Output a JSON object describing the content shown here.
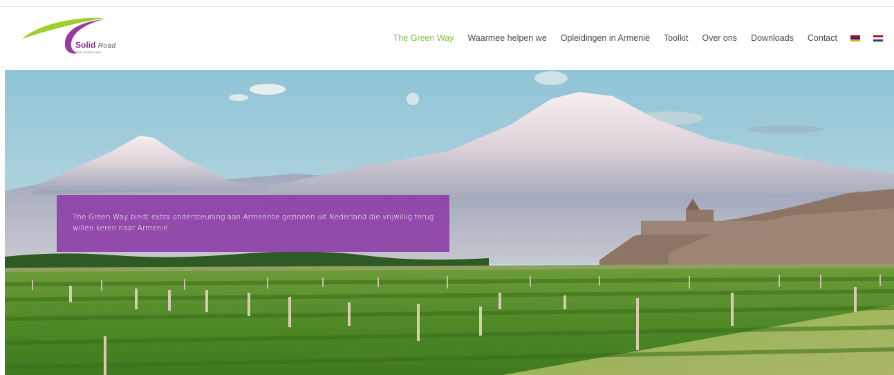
{
  "logo": {
    "name_main": "Solid",
    "name_road": "Road",
    "tagline": "THE GREEN WAY",
    "colors": {
      "swoosh_green": "#9bd02f",
      "swoosh_purple": "#9a3aa0"
    }
  },
  "nav": {
    "items": [
      {
        "label": "The Green Way",
        "active": true
      },
      {
        "label": "Waarmee helpen we",
        "active": false
      },
      {
        "label": "Opleidingen in Armenië",
        "active": false
      },
      {
        "label": "Toolkit",
        "active": false
      },
      {
        "label": "Over ons",
        "active": false
      },
      {
        "label": "Downloads",
        "active": false
      },
      {
        "label": "Contact",
        "active": false
      }
    ],
    "languages": [
      {
        "code": "hy",
        "icon": "armenia-flag-icon"
      },
      {
        "code": "nl",
        "icon": "netherlands-flag-icon"
      }
    ],
    "active_color": "#7dc341"
  },
  "hero": {
    "caption": "The Green Way biedt extra ondersteuning aan Armeense gezinnen uit Nederland die vrijwillig terug willen keren naar Armenië",
    "caption_bg": "#8e40a8"
  }
}
